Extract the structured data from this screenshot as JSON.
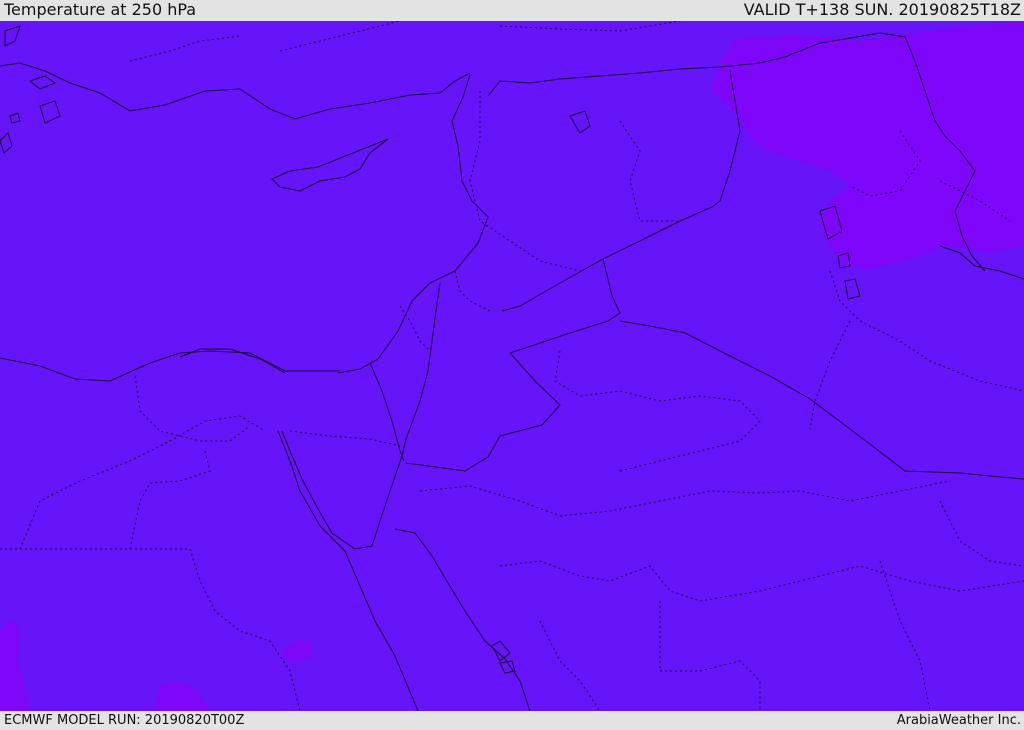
{
  "header": {
    "title": "Temperature at 250 hPa",
    "valid": "VALID T+138 SUN. 20190825T18Z"
  },
  "footer": {
    "model_run": "ECMWF MODEL RUN: 20190820T00Z",
    "credit": "ArabiaWeather Inc."
  },
  "map": {
    "field_color": "#6614f9",
    "warmer_color": "#7d06fb",
    "line_color": "#1b0a3c"
  }
}
